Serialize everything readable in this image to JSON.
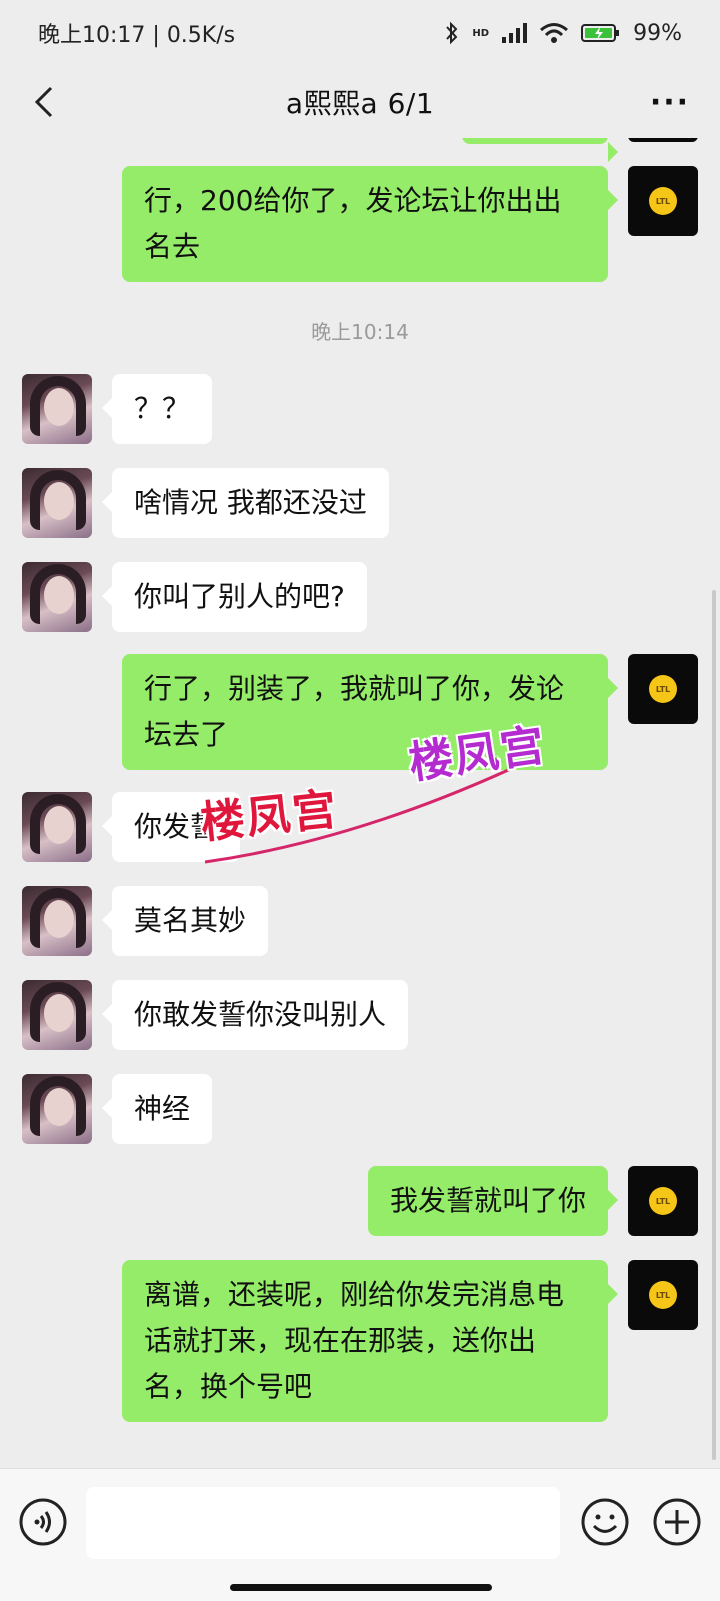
{
  "status_bar": {
    "time": "晚上10:17",
    "net_speed": "0.5K/s",
    "signal_label": "HD",
    "battery": "99%"
  },
  "nav": {
    "title": "a熙熙a  6/1",
    "more": "···"
  },
  "chat": {
    "timestamp": "晚上10:14",
    "messages": [
      {
        "side": "out",
        "text": "行，200给你了，发论坛让你出出名去"
      },
      {
        "side": "in",
        "text": "？？"
      },
      {
        "side": "in",
        "text": "啥情况 我都还没过"
      },
      {
        "side": "in",
        "text": "你叫了别人的吧?"
      },
      {
        "side": "out",
        "text": "行了，别装了，我就叫了你，发论坛去了"
      },
      {
        "side": "in",
        "text": "你发誓"
      },
      {
        "side": "in",
        "text": "莫名其妙"
      },
      {
        "side": "in",
        "text": "你敢发誓你没叫别人"
      },
      {
        "side": "in",
        "text": "神经"
      },
      {
        "side": "out",
        "text": "我发誓就叫了你"
      },
      {
        "side": "out",
        "text": "离谱，还装呢，刚给你发完消息电话就打来，现在在那装，送你出名，换个号吧"
      }
    ]
  },
  "watermark": {
    "text": "楼凤宫"
  },
  "avatar_logo": "LTL",
  "input": {
    "value": "",
    "placeholder": ""
  },
  "colors": {
    "background": "#ededed",
    "bubble_out": "#95ec69",
    "bubble_in": "#ffffff",
    "watermark_red": "#e0173c",
    "watermark_purple": "#b42bd0"
  }
}
